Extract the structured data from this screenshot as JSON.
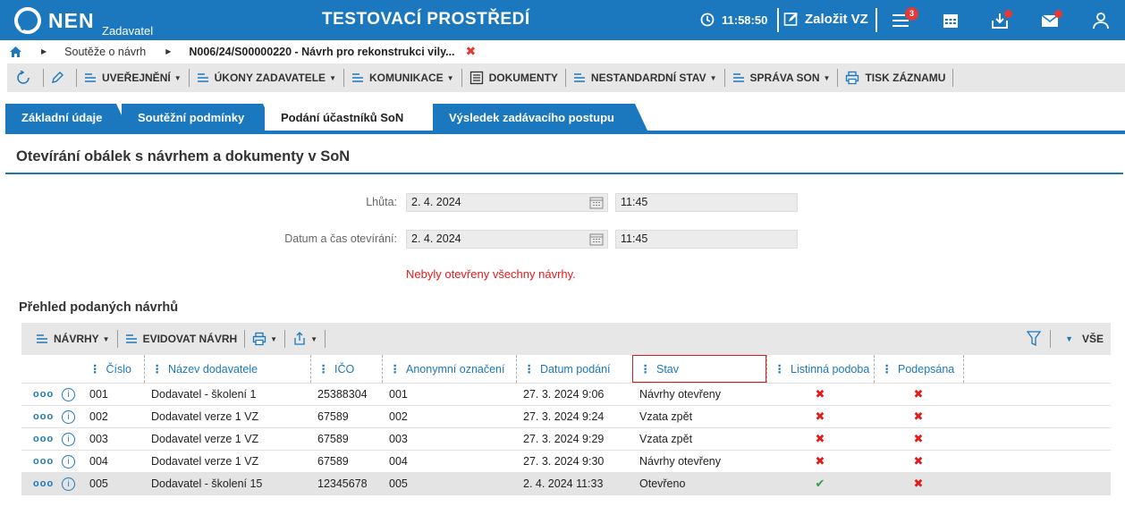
{
  "topbar": {
    "logo_text": "NEN",
    "logo_sub": "Zadavatel",
    "env_title": "TESTOVACÍ PROSTŘEDÍ",
    "time": "11:58:50",
    "create_label": "Založit VZ",
    "menu_badge": "3",
    "accent": "#1b78be",
    "alert_color": "#e53935"
  },
  "breadcrumb": {
    "items": [
      "Soutěže o návrh",
      "N006/24/S00000220 - Návrh pro rekonstrukci vily..."
    ],
    "close_symbol": "✖"
  },
  "actionbar": {
    "items": [
      "UVEŘEJNĚNÍ",
      "ÚKONY ZADAVATELE",
      "KOMUNIKACE",
      "DOKUMENTY",
      "NESTANDARDNÍ STAV",
      "SPRÁVA SON",
      "TISK ZÁZNAMU"
    ]
  },
  "tabs": [
    "Základní údaje",
    "Soutěžní podmínky",
    "Podání účastníků SoN",
    "Výsledek zadávacího postupu"
  ],
  "active_tab": "Podání účastníků SoN",
  "section": {
    "title": "Otevírání obálek s návrhem a dokumenty v SoN",
    "deadline_label": "Lhůta:",
    "deadline_date": "2. 4. 2024",
    "deadline_time": "11:45",
    "opening_label": "Datum a čas otevírání:",
    "opening_date": "2. 4. 2024",
    "opening_time": "11:45",
    "warning": "Nebyly otevřeny všechny návrhy."
  },
  "grid": {
    "title": "Přehled podaných návrhů",
    "toolbar": {
      "navrhy": "NÁVRHY",
      "evidovat": "EVIDOVAT NÁVRH",
      "filter_all": "VŠE"
    },
    "columns": [
      "Číslo",
      "Název dodavatele",
      "IČO",
      "Anonymní označení",
      "Datum podání",
      "Stav",
      "Listinná podoba",
      "Podepsána"
    ],
    "rows": [
      {
        "cislo": "001",
        "nazev": "Dodavatel - školení 1",
        "ico": "25388304",
        "anon": "001",
        "datum": "27. 3. 2024 9:06",
        "stav": "Návrhy otevřeny",
        "listinna": "✖",
        "podepsana": "✖"
      },
      {
        "cislo": "002",
        "nazev": "Dodavatel verze 1 VZ",
        "ico": "67589",
        "anon": "002",
        "datum": "27. 3. 2024 9:24",
        "stav": "Vzata zpět",
        "listinna": "✖",
        "podepsana": "✖"
      },
      {
        "cislo": "003",
        "nazev": "Dodavatel verze 1 VZ",
        "ico": "67589",
        "anon": "003",
        "datum": "27. 3. 2024 9:29",
        "stav": "Vzata zpět",
        "listinna": "✖",
        "podepsana": "✖"
      },
      {
        "cislo": "004",
        "nazev": "Dodavatel verze 1 VZ",
        "ico": "67589",
        "anon": "004",
        "datum": "27. 3. 2024 9:30",
        "stav": "Návrhy otevřeny",
        "listinna": "✖",
        "podepsana": "✖"
      },
      {
        "cislo": "005",
        "nazev": "Dodavatel - školení 15",
        "ico": "12345678",
        "anon": "005",
        "datum": "2. 4. 2024 11:33",
        "stav": "Otevřeno",
        "listinna": "✔",
        "podepsana": "✖"
      }
    ],
    "row_dots": "ooo",
    "info_symbol": "i"
  }
}
